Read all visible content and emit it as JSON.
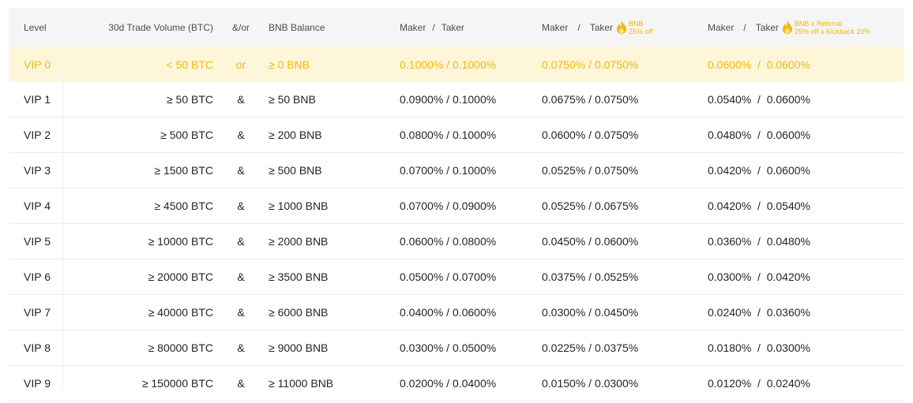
{
  "header": {
    "level": "Level",
    "volume": "30d Trade Volume (BTC)",
    "andor": "&/or",
    "bnb_balance": "BNB Balance",
    "fee1": {
      "maker": "Maker",
      "sep": "/",
      "taker": "Taker"
    },
    "fee2": {
      "maker": "Maker",
      "sep": "/",
      "taker": "Taker",
      "badge_line1": "BNB",
      "badge_line2": "25% off"
    },
    "fee3": {
      "maker": "Maker",
      "sep": "/",
      "taker": "Taker",
      "badge_line1": "BNB x Referral",
      "badge_line2": "25% off x Kickback 20%"
    }
  },
  "rows": [
    {
      "level": "VIP 0",
      "volume": "< 50 BTC",
      "andor": "or",
      "bnb": "≥ 0 BNB",
      "fee1": "0.1000% / 0.1000%",
      "fee2": "0.0750% / 0.0750%",
      "fee3": "0.0600%  /  0.0600%"
    },
    {
      "level": "VIP 1",
      "volume": "≥ 50 BTC",
      "andor": "&",
      "bnb": "≥ 50 BNB",
      "fee1": "0.0900% / 0.1000%",
      "fee2": "0.0675% / 0.0750%",
      "fee3": "0.0540%  /  0.0600%"
    },
    {
      "level": "VIP 2",
      "volume": "≥ 500 BTC",
      "andor": "&",
      "bnb": "≥ 200 BNB",
      "fee1": "0.0800% / 0.1000%",
      "fee2": "0.0600% / 0.0750%",
      "fee3": "0.0480%  /  0.0600%"
    },
    {
      "level": "VIP 3",
      "volume": "≥ 1500 BTC",
      "andor": "&",
      "bnb": "≥ 500 BNB",
      "fee1": "0.0700% / 0.1000%",
      "fee2": "0.0525% / 0.0750%",
      "fee3": "0.0420%  /  0.0600%"
    },
    {
      "level": "VIP 4",
      "volume": "≥ 4500 BTC",
      "andor": "&",
      "bnb": "≥ 1000 BNB",
      "fee1": "0.0700% / 0.0900%",
      "fee2": "0.0525% / 0.0675%",
      "fee3": "0.0420%  /  0.0540%"
    },
    {
      "level": "VIP 5",
      "volume": "≥ 10000 BTC",
      "andor": "&",
      "bnb": "≥ 2000 BNB",
      "fee1": "0.0600% / 0.0800%",
      "fee2": "0.0450% / 0.0600%",
      "fee3": "0.0360%  /  0.0480%"
    },
    {
      "level": "VIP 6",
      "volume": "≥ 20000 BTC",
      "andor": "&",
      "bnb": "≥ 3500 BNB",
      "fee1": "0.0500% / 0.0700%",
      "fee2": "0.0375% / 0.0525%",
      "fee3": "0.0300%  /  0.0420%"
    },
    {
      "level": "VIP 7",
      "volume": "≥ 40000 BTC",
      "andor": "&",
      "bnb": "≥ 6000 BNB",
      "fee1": "0.0400% / 0.0600%",
      "fee2": "0.0300% / 0.0450%",
      "fee3": "0.0240%  /  0.0360%"
    },
    {
      "level": "VIP 8",
      "volume": "≥ 80000 BTC",
      "andor": "&",
      "bnb": "≥ 9000 BNB",
      "fee1": "0.0300% / 0.0500%",
      "fee2": "0.0225% / 0.0375%",
      "fee3": "0.0180%  /  0.0300%"
    },
    {
      "level": "VIP 9",
      "volume": "≥ 150000 BTC",
      "andor": "&",
      "bnb": "≥ 11000 BNB",
      "fee1": "0.0200% / 0.0400%",
      "fee2": "0.0150% / 0.0300%",
      "fee3": "0.0120%  /  0.0240%"
    }
  ],
  "colors": {
    "accent": "#f0b90b",
    "highlight_bg": "#fef6d8",
    "header_bg": "#f5f5f5",
    "border": "#eaecef"
  },
  "icons": {
    "badge": "flame-icon"
  }
}
